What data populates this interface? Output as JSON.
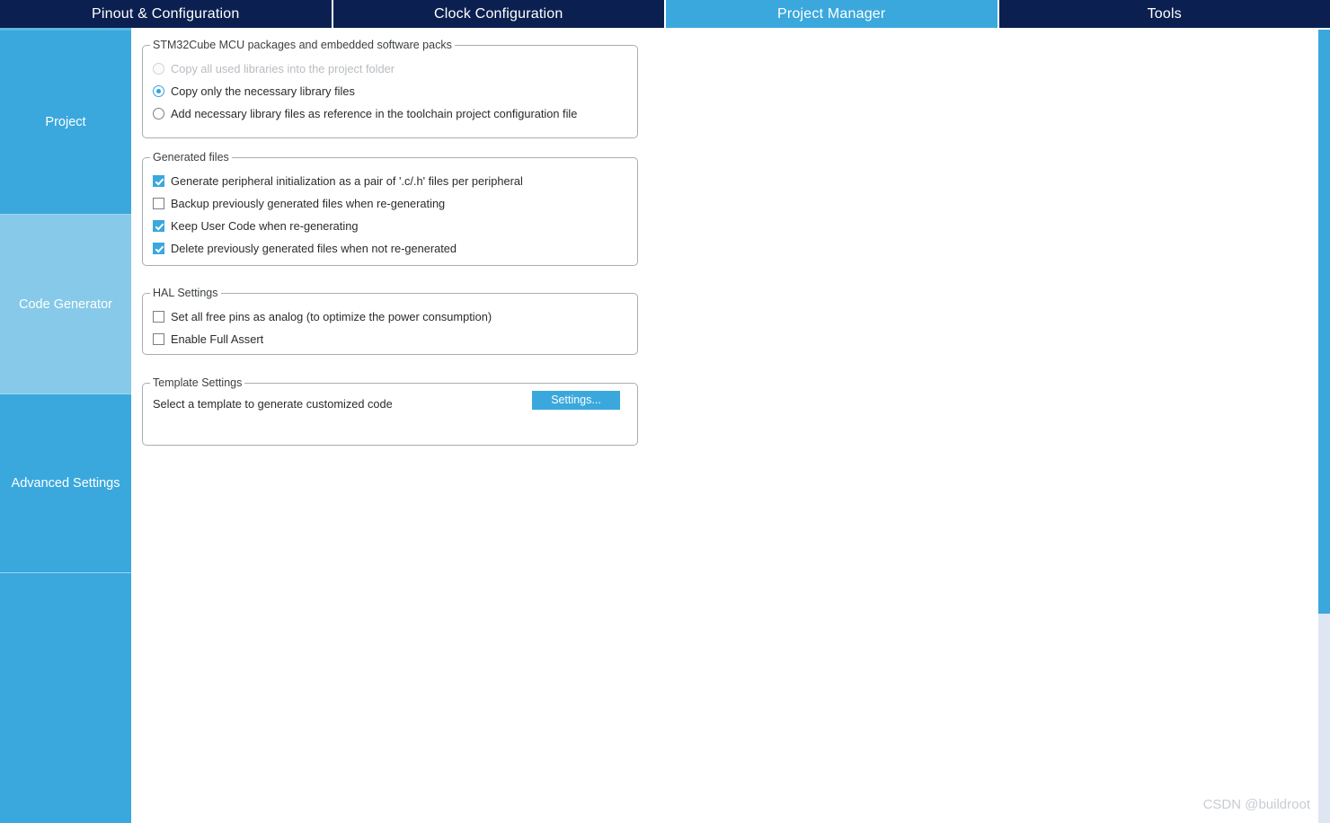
{
  "tabs": [
    {
      "label": "Pinout & Configuration",
      "active": false
    },
    {
      "label": "Clock Configuration",
      "active": false
    },
    {
      "label": "Project Manager",
      "active": true
    },
    {
      "label": "Tools",
      "active": false
    }
  ],
  "sidebar": {
    "items": [
      {
        "label": "Project",
        "selected": false
      },
      {
        "label": "Code Generator",
        "selected": true
      },
      {
        "label": "Advanced Settings",
        "selected": false
      }
    ]
  },
  "groups": {
    "packages": {
      "title": "STM32Cube MCU packages and embedded software packs",
      "options": [
        {
          "label": "Copy all used libraries into the project folder",
          "state": "disabled"
        },
        {
          "label": "Copy only the necessary library files",
          "state": "checked"
        },
        {
          "label": "Add necessary library files as reference in the toolchain project configuration file",
          "state": "unchecked"
        }
      ]
    },
    "generated_files": {
      "title": "Generated files",
      "options": [
        {
          "label": "Generate peripheral initialization as a pair of '.c/.h' files per peripheral",
          "state": "checked"
        },
        {
          "label": "Backup previously generated files when re-generating",
          "state": "unchecked"
        },
        {
          "label": "Keep User Code when re-generating",
          "state": "checked"
        },
        {
          "label": "Delete previously generated files when not re-generated",
          "state": "checked"
        }
      ]
    },
    "hal_settings": {
      "title": "HAL Settings",
      "options": [
        {
          "label": "Set all free pins as analog (to optimize the power consumption)",
          "state": "unchecked"
        },
        {
          "label": "Enable Full Assert",
          "state": "unchecked"
        }
      ]
    },
    "template_settings": {
      "title": "Template Settings",
      "description": "Select a template to generate customized code",
      "button_label": "Settings..."
    }
  },
  "watermark": "CSDN @buildroot",
  "colors": {
    "tabbar_bg": "#0b2050",
    "accent": "#3aa8dd",
    "sidebar_selected": "#86c9e8"
  }
}
